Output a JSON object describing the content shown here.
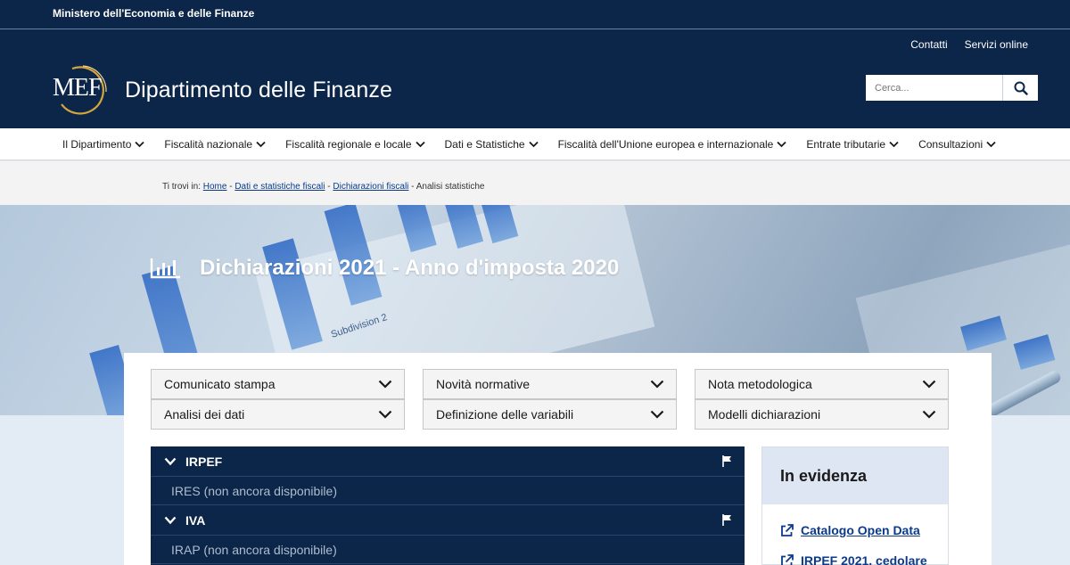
{
  "topbar": {
    "ministry": "Ministero dell'Economia e delle Finanze"
  },
  "header": {
    "links": [
      "Contatti",
      "Servizi online"
    ],
    "logo_text": "MEF",
    "title": "Dipartimento delle Finanze",
    "search_placeholder": "Cerca..."
  },
  "nav": {
    "items": [
      "Il Dipartimento",
      "Fiscalità nazionale",
      "Fiscalità regionale e locale",
      "Dati e Statistiche",
      "Fiscalità dell'Unione europea e internazionale",
      "Entrate tributarie",
      "Consultazioni"
    ]
  },
  "breadcrumb": {
    "prefix": "Ti trovi in:",
    "links": [
      "Home",
      "Dati e statistiche fiscali",
      "Dichiarazioni fiscali"
    ],
    "current": "Analisi statistiche"
  },
  "hero": {
    "title": "Dichiarazioni 2021 - Anno d'imposta 2020",
    "decor_text": "Subdivision 2"
  },
  "accordions": [
    "Comunicato stampa",
    "Novità normative",
    "Nota metodologica",
    "Analisi dei dati",
    "Definizione delle variabili",
    "Modelli dichiarazioni"
  ],
  "tax_list": {
    "rows": [
      {
        "label": "IRPEF",
        "type": "open"
      },
      {
        "label": "IRES (non ancora disponibile)",
        "type": "sub"
      },
      {
        "label": "IVA",
        "type": "open"
      },
      {
        "label": "IRAP (non ancora disponibile)",
        "type": "sub"
      }
    ]
  },
  "sidebar": {
    "heading": "In evidenza",
    "links": [
      "Catalogo Open Data",
      "IRPEF 2021, cedolare"
    ]
  },
  "colors": {
    "navy": "#0b2648",
    "link": "#0b3a8a",
    "panel_head": "#dde6f2"
  }
}
